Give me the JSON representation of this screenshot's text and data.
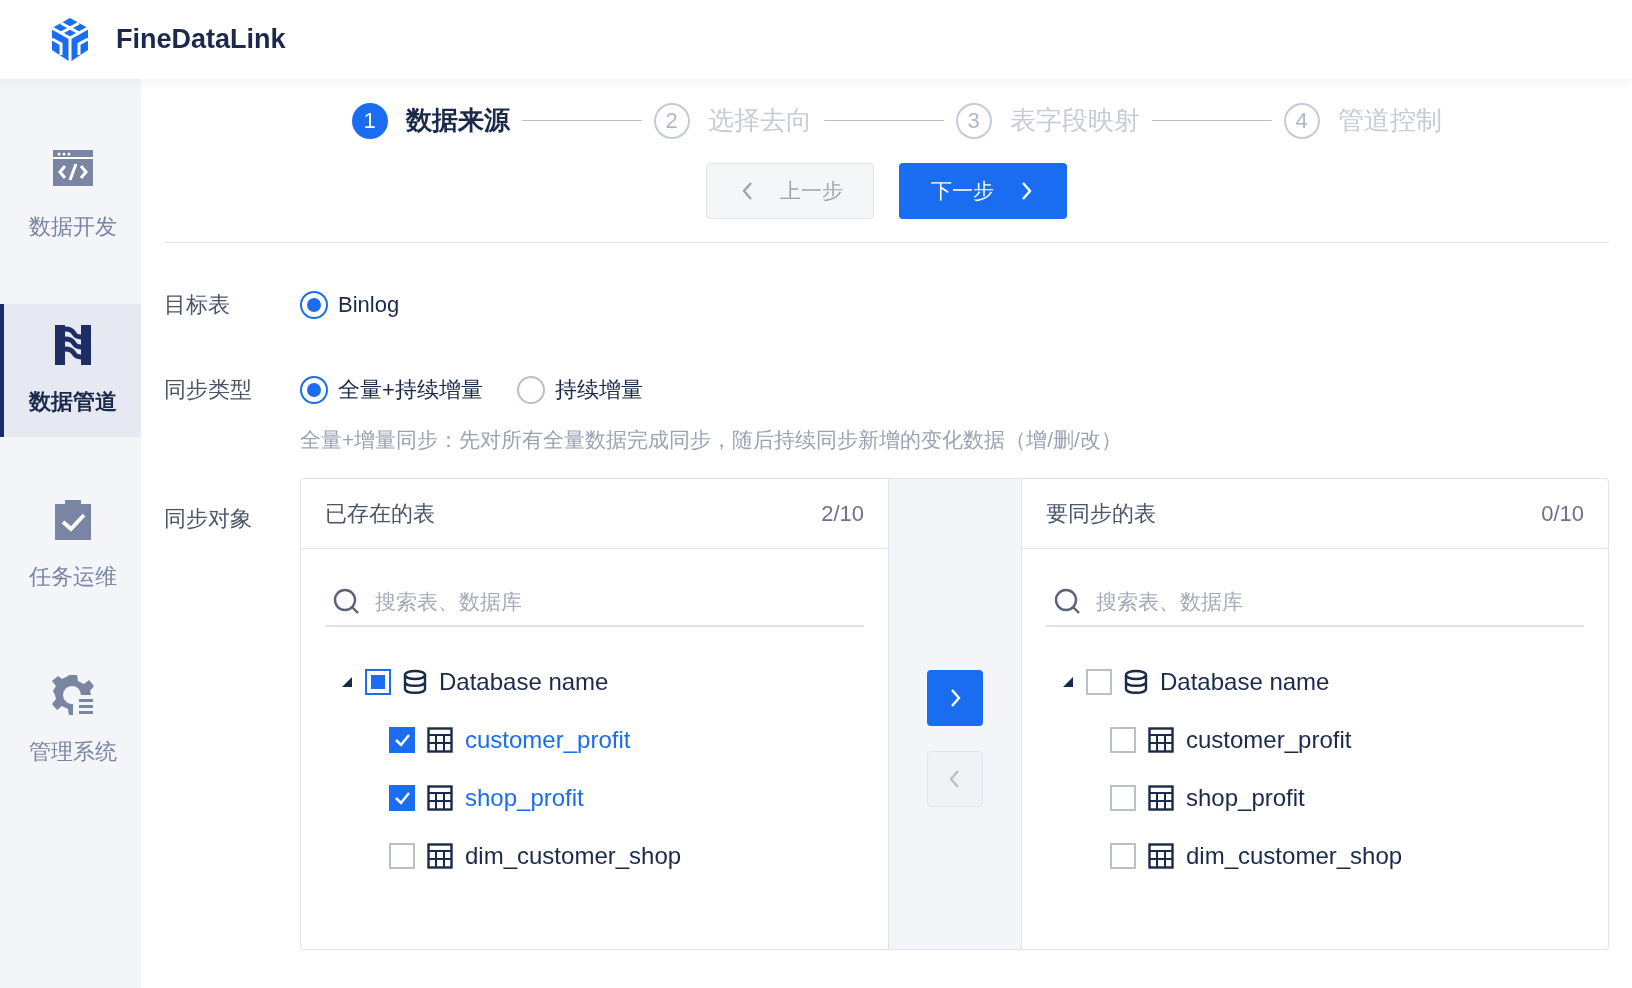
{
  "app": {
    "title": "FineDataLink"
  },
  "sidebar": {
    "items": [
      {
        "label": "数据开发",
        "kind": "code",
        "selected": false
      },
      {
        "label": "数据管道",
        "kind": "pipe",
        "selected": true
      },
      {
        "label": "任务运维",
        "kind": "clipboard",
        "selected": false
      },
      {
        "label": "管理系统",
        "kind": "gear",
        "selected": false
      }
    ]
  },
  "steps": [
    {
      "number": "1",
      "label": "数据来源",
      "active": true
    },
    {
      "number": "2",
      "label": "选择去向",
      "active": false
    },
    {
      "number": "3",
      "label": "表字段映射",
      "active": false
    },
    {
      "number": "4",
      "label": "管道控制",
      "active": false
    }
  ],
  "nav_buttons": [
    {
      "label": "上一步",
      "kind": "prev",
      "disabled": true
    },
    {
      "label": "下一步",
      "kind": "next",
      "disabled": false
    }
  ],
  "form": {
    "target": {
      "label": "目标表",
      "options": [
        {
          "label": "Binlog",
          "selected": true
        }
      ]
    },
    "sync_type": {
      "label": "同步类型",
      "options": [
        {
          "label": "全量+持续增量",
          "selected": true
        },
        {
          "label": "持续增量",
          "selected": false
        }
      ],
      "description": "全量+增量同步：先对所有全量数据完成同步，随后持续同步新增的变化数据（增/删/改）"
    },
    "sync_objects": {
      "label": "同步对象",
      "panels": [
        {
          "title": "已存在的表",
          "count": "2/10",
          "search_placeholder": "搜索表、数据库",
          "tree": [
            {
              "label": "Database name",
              "expanded": true,
              "checked": false,
              "indeterminate": true,
              "children": [
                {
                  "label": "customer_profit",
                  "checked": true
                },
                {
                  "label": "shop_profit",
                  "checked": true
                },
                {
                  "label": "dim_customer_shop",
                  "checked": false
                }
              ]
            }
          ]
        },
        {
          "title": "要同步的表",
          "count": "0/10",
          "search_placeholder": "搜索表、数据库",
          "tree": [
            {
              "label": "Database name",
              "expanded": true,
              "checked": false,
              "indeterminate": false,
              "children": [
                {
                  "label": "customer_profit",
                  "checked": false
                },
                {
                  "label": "shop_profit",
                  "checked": false
                },
                {
                  "label": "dim_customer_shop",
                  "checked": false
                }
              ]
            }
          ]
        }
      ],
      "transfer_buttons": [
        {
          "kind": "right",
          "disabled": false
        },
        {
          "kind": "left",
          "disabled": true
        }
      ]
    }
  }
}
